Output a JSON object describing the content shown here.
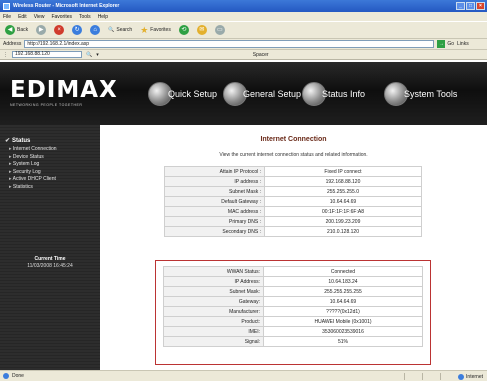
{
  "window": {
    "title": "Wireless Router - Microsoft Internet Explorer"
  },
  "menu": [
    "File",
    "Edit",
    "View",
    "Favorites",
    "Tools",
    "Help"
  ],
  "toolbar": {
    "back_label": "Back",
    "search_label": "Search",
    "favorites_label": "Favorites"
  },
  "address": {
    "label": "Address",
    "value": "http://192.168.2.1/index.asp",
    "go_label": "Go",
    "links_label": "Links"
  },
  "links_bar": {
    "value": "192.168.88.120",
    "spacer": "Spacer"
  },
  "brand": {
    "logo": "EDIMAX",
    "tagline": "NETWORKING PEOPLE TOGETHER"
  },
  "nav": [
    "Quick Setup",
    "General Setup",
    "Status Info",
    "System Tools"
  ],
  "sidebar": {
    "title": "Status",
    "items": [
      "Internet Connection",
      "Device Status",
      "System Log",
      "Security Log",
      "Active DHCP Client",
      "Statistics"
    ],
    "current_time_label": "Current Time",
    "current_time_value": "11/03/2008 16:45:24"
  },
  "content": {
    "title": "Internet Connection",
    "description": "View the current internet connection status and related information.",
    "table1": [
      {
        "k": "Attain IP Protocol :",
        "v": "Fixed IP connect"
      },
      {
        "k": "IP address :",
        "v": "192.168.88.120"
      },
      {
        "k": "Subnet Mask :",
        "v": "255.255.255.0"
      },
      {
        "k": "Default Gateway :",
        "v": "10.64.64.69"
      },
      {
        "k": "MAC address :",
        "v": "00:1F:1F:1F:6F:A8"
      },
      {
        "k": "Primary DNS :",
        "v": "200.199.23.209"
      },
      {
        "k": "Secondary DNS :",
        "v": "210.0.128.120"
      }
    ],
    "table2": [
      {
        "k": "WWAN Status:",
        "v": "Connected"
      },
      {
        "k": "IP Address:",
        "v": "10.64.183.24"
      },
      {
        "k": "Subnet Mask:",
        "v": "255.255.255.255"
      },
      {
        "k": "Gateway:",
        "v": "10.64.64.69"
      },
      {
        "k": "Manufacturer:",
        "v": "?????(0x12d1)"
      },
      {
        "k": "Product:",
        "v": "HUAWEI Mobile (0x1001)"
      },
      {
        "k": "IMEI:",
        "v": "353060023539016"
      },
      {
        "k": "Signal:",
        "v": "51%"
      }
    ]
  },
  "statusbar": {
    "left": "Done",
    "zone": "Internet"
  }
}
